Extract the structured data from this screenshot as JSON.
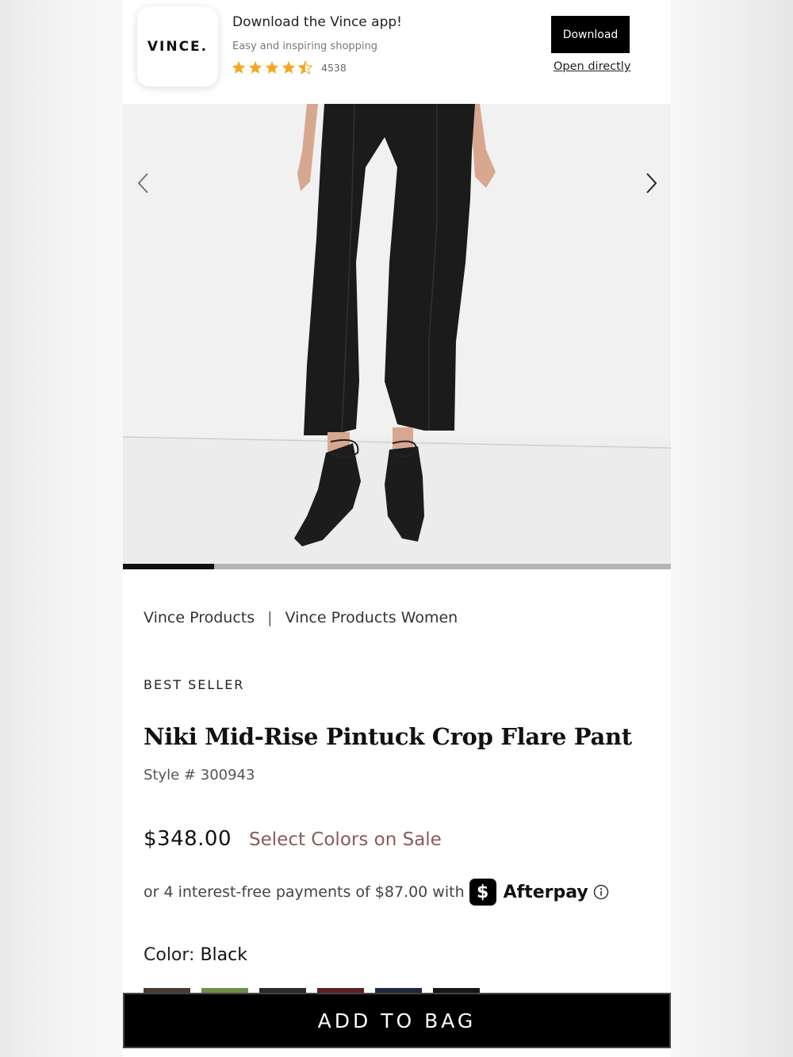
{
  "banner": {
    "logo_text": "VINCE.",
    "title": "Download the Vince app!",
    "subtitle": "Easy and inspiring shopping",
    "rating": 4.5,
    "rating_count": "4538",
    "download_label": "Download",
    "open_label": "Open directly"
  },
  "gallery": {
    "progress": 0.1667
  },
  "breadcrumb": {
    "items": [
      "Vince Products",
      "Vince Products Women"
    ],
    "separator": "|"
  },
  "product": {
    "badge": "BEST SELLER",
    "title": "Niki Mid-Rise Pintuck Crop Flare Pant",
    "style": "Style # 300943",
    "price": "$348.00",
    "sale_link": "Select Colors on Sale",
    "afterpay_text": "or 4 interest-free payments of $87.00 with",
    "afterpay_brand": "Afterpay",
    "color_label": "Color:",
    "color_value": "Black",
    "swatch_colors": [
      "#4a3a34",
      "#6f8c4c",
      "#2b2b2b",
      "#5c1f22",
      "#1e2740",
      "#161616"
    ]
  },
  "cta": {
    "add_to_bag": "ADD TO BAG"
  },
  "colors": {
    "sale_text": "#8a5a5a",
    "star": "#f5a623",
    "cta_bg": "#000000"
  }
}
